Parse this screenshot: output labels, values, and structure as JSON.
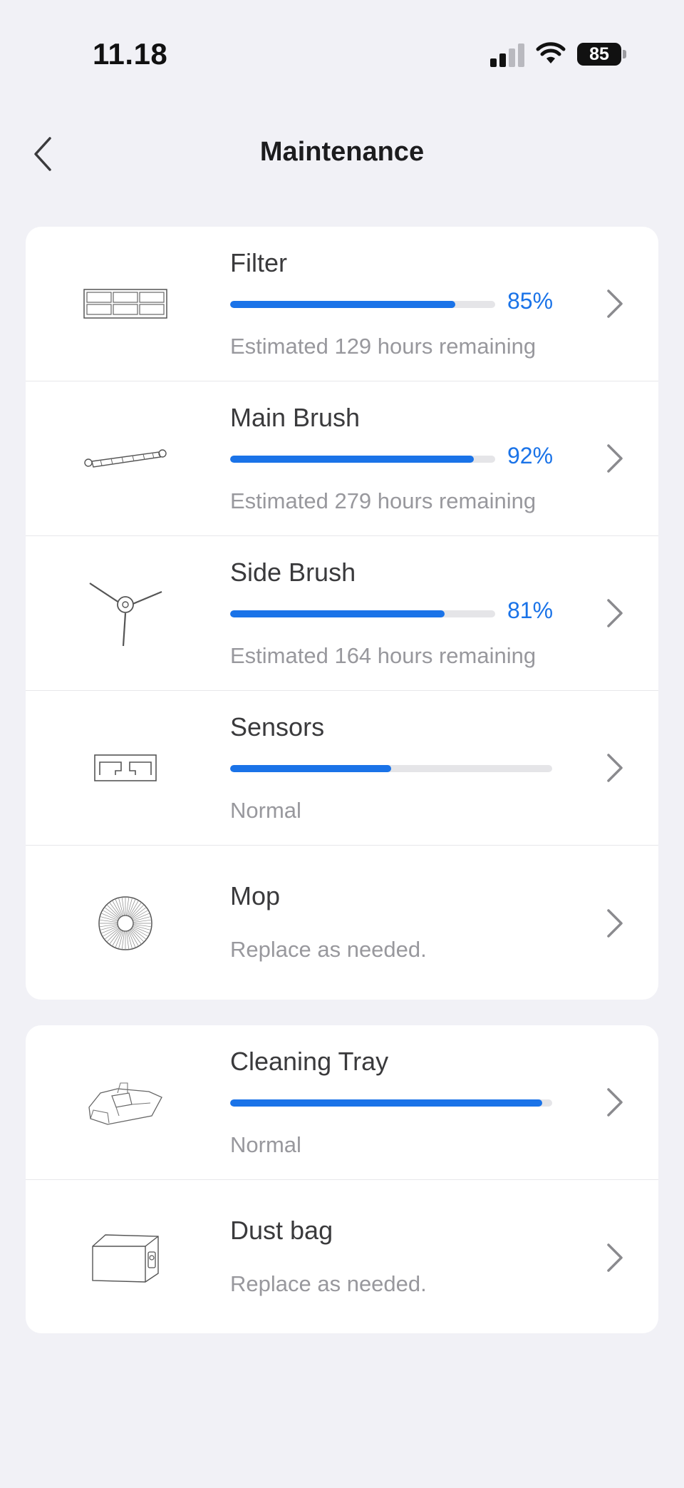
{
  "status_bar": {
    "time": "11.18",
    "battery": "85"
  },
  "nav": {
    "title": "Maintenance"
  },
  "group1": [
    {
      "name": "Filter",
      "percent_label": "85%",
      "level": 0.85,
      "subtitle": "Estimated 129 hours remaining",
      "icon": "filter-icon"
    },
    {
      "name": "Main Brush",
      "percent_label": "92%",
      "level": 0.92,
      "subtitle": "Estimated 279 hours remaining",
      "icon": "main-brush-icon"
    },
    {
      "name": "Side Brush",
      "percent_label": "81%",
      "level": 0.81,
      "subtitle": "Estimated 164 hours remaining",
      "icon": "side-brush-icon"
    },
    {
      "name": "Sensors",
      "level": 0.5,
      "subtitle": "Normal",
      "icon": "sensors-icon"
    },
    {
      "name": "Mop",
      "subtitle": "Replace as needed.",
      "icon": "mop-icon"
    }
  ],
  "group2": [
    {
      "name": "Cleaning Tray",
      "level": 0.97,
      "subtitle": "Normal",
      "icon": "cleaning-tray-icon"
    },
    {
      "name": "Dust bag",
      "subtitle": "Replace as needed.",
      "icon": "dust-bag-icon"
    }
  ],
  "colors": {
    "accent": "#1a73e8",
    "background": "#f1f1f6"
  }
}
